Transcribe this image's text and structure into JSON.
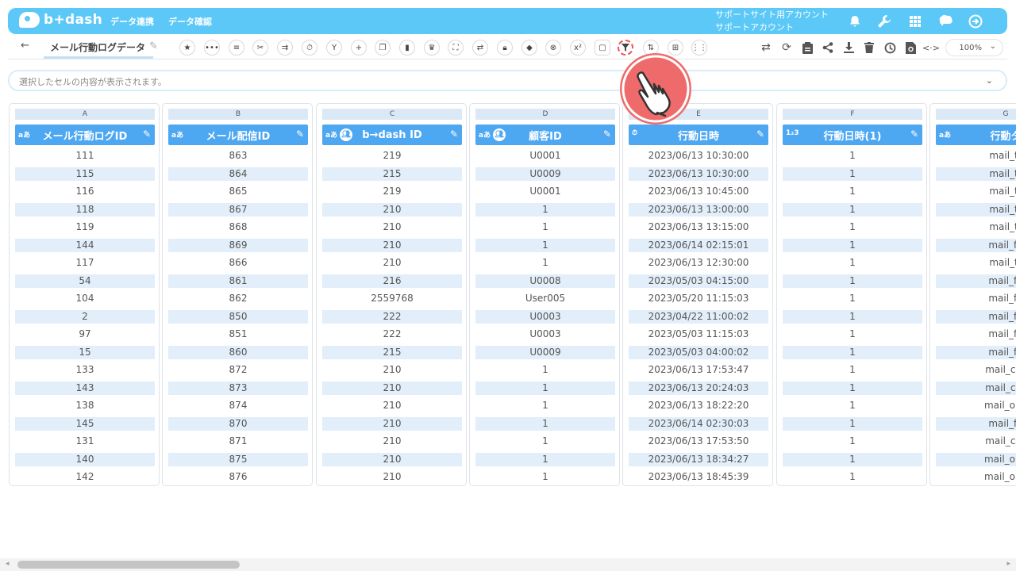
{
  "app": {
    "logo_text": "b+dash",
    "nav": [
      "データ連携",
      "データ確認"
    ],
    "account_line1": "サポートサイト用アカウント",
    "account_line2": "サポートアカウント",
    "header_icons": [
      "bell-icon",
      "wrench-icon",
      "grid-icon",
      "brain-icon",
      "logout-icon"
    ]
  },
  "toolbar": {
    "back_label": "←",
    "sheet_name": "メール行動ログデータ",
    "tool_icons": [
      "star-icon",
      "dots-icon",
      "list-icon",
      "tools-icon",
      "merge-icon",
      "timer-icon",
      "fork-icon",
      "plus-icon",
      "copy-icon",
      "trash-icon",
      "crown-icon",
      "expand-icon",
      "swap-icon",
      "lock-icon",
      "cube-icon",
      "cancel-icon",
      "function-icon",
      "frame-icon",
      "filter-icon",
      "sort-icon",
      "table-icon",
      "split-icon"
    ],
    "right_icons": [
      "transfer-icon",
      "refresh-icon",
      "clipboard-icon",
      "share-icon",
      "download-icon",
      "delete-icon",
      "history-icon",
      "restore-icon",
      "code-icon"
    ],
    "zoom": "100%"
  },
  "cellbar": {
    "placeholder": "選択したセルの内容が表示されます。"
  },
  "columns": [
    {
      "letter": "A",
      "name": "メール行動ログID",
      "type": "aあ",
      "group": false,
      "values": [
        "111",
        "115",
        "116",
        "118",
        "119",
        "144",
        "117",
        "54",
        "104",
        "2",
        "97",
        "15",
        "133",
        "143",
        "138",
        "145",
        "131",
        "140",
        "142"
      ]
    },
    {
      "letter": "B",
      "name": "メール配信ID",
      "type": "aあ",
      "group": false,
      "values": [
        "863",
        "864",
        "865",
        "867",
        "868",
        "869",
        "866",
        "861",
        "862",
        "850",
        "851",
        "860",
        "872",
        "873",
        "874",
        "870",
        "871",
        "875",
        "876"
      ]
    },
    {
      "letter": "C",
      "name": "b→dash ID",
      "type": "aあ",
      "group": true,
      "values": [
        "219",
        "215",
        "219",
        "210",
        "210",
        "210",
        "210",
        "216",
        "2559768",
        "222",
        "222",
        "215",
        "210",
        "210",
        "210",
        "210",
        "210",
        "210",
        "210"
      ]
    },
    {
      "letter": "D",
      "name": "顧客ID",
      "type": "aあ",
      "group": true,
      "values": [
        "U0001",
        "U0009",
        "U0001",
        "1",
        "1",
        "1",
        "1",
        "U0008",
        "User005",
        "U0003",
        "U0003",
        "U0009",
        "1",
        "1",
        "1",
        "1",
        "1",
        "1",
        "1"
      ]
    },
    {
      "letter": "E",
      "name": "行動日時",
      "type": "⏱",
      "group": false,
      "values": [
        "2023/06/13 10:30:00",
        "2023/06/13 10:30:00",
        "2023/06/13 10:45:00",
        "2023/06/13 13:00:00",
        "2023/06/13 13:15:00",
        "2023/06/14 02:15:01",
        "2023/06/13 12:30:00",
        "2023/05/03 04:15:00",
        "2023/05/20 11:15:03",
        "2023/04/22 11:00:02",
        "2023/05/03 11:15:03",
        "2023/05/03 04:00:02",
        "2023/06/13 17:53:47",
        "2023/06/13 20:24:03",
        "2023/06/13 18:22:20",
        "2023/06/14 02:30:03",
        "2023/06/13 17:53:50",
        "2023/06/13 18:34:27",
        "2023/06/13 18:45:39"
      ]
    },
    {
      "letter": "F",
      "name": "行動日時(1)",
      "type": "1₂3",
      "group": false,
      "values": [
        "1",
        "1",
        "1",
        "1",
        "1",
        "1",
        "1",
        "1",
        "1",
        "1",
        "1",
        "1",
        "1",
        "1",
        "1",
        "1",
        "1",
        "1",
        "1"
      ]
    },
    {
      "letter": "G",
      "name": "行動タ",
      "type": "aあ",
      "group": false,
      "values": [
        "mail_tr",
        "mail_tr",
        "mail_tr",
        "mail_tr",
        "mail_tr",
        "mail_fa",
        "mail_tr",
        "mail_fa",
        "mail_fa",
        "mail_fa",
        "mail_fa",
        "mail_fa",
        "mail_clic",
        "mail_clic",
        "mail_ope",
        "mail_fa",
        "mail_clic",
        "mail_ope",
        "mail_ope"
      ]
    }
  ]
}
